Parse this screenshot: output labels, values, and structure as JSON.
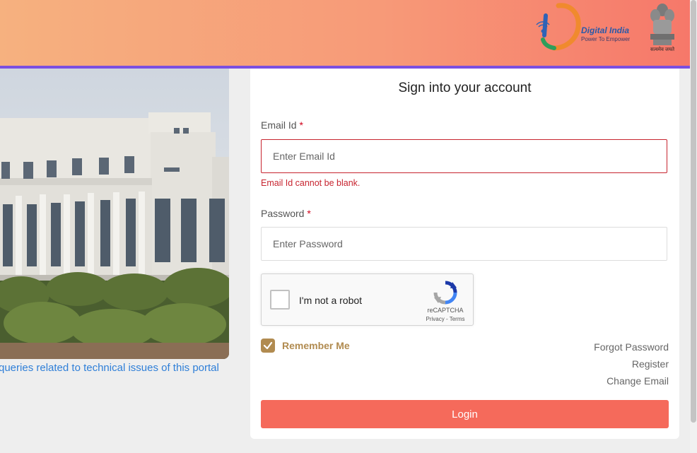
{
  "header": {
    "brand_title": "Digital India",
    "brand_tagline": "Power To Empower",
    "emblem_caption": "सत्यमेव जयते",
    "colors": {
      "gradient_start": "#f6b17f",
      "gradient_end": "#f6786a",
      "accent_line": "#7b4fe0"
    }
  },
  "left": {
    "portal_link": "queries related to technical issues of this portal"
  },
  "login": {
    "title": "Sign into your account",
    "email_label": "Email Id",
    "required_mark": "*",
    "email_placeholder": "Enter Email Id",
    "email_value": "",
    "email_error": "Email Id cannot be blank.",
    "password_label": "Password",
    "password_placeholder": "Enter Password",
    "password_value": "",
    "captcha": {
      "label": "I'm not a robot",
      "brand": "reCAPTCHA",
      "terms": "Privacy - Terms",
      "icon": "recaptcha-icon"
    },
    "remember_label": "Remember Me",
    "remember_checked": true,
    "links": {
      "forgot_password": "Forgot Password",
      "register": "Register",
      "change_email": "Change Email"
    },
    "submit_label": "Login",
    "colors": {
      "button": "#f56a5b",
      "error": "#c7242f",
      "remember": "#b18b50"
    }
  }
}
